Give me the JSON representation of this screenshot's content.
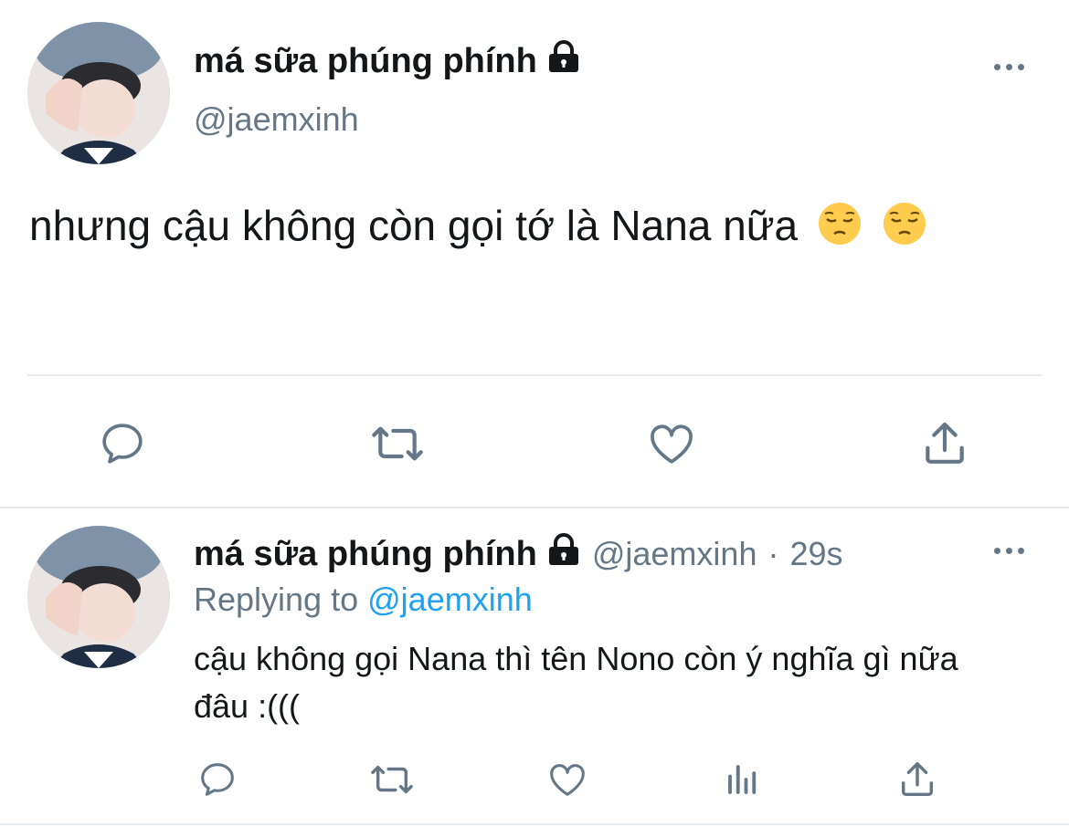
{
  "main_tweet": {
    "display_name": "má sữa phúng phính",
    "handle": "@jaemxinh",
    "text": "nhưng cậu không còn gọi tớ là Nana nữa",
    "emojis": [
      "pensive-face-emoji",
      "pensive-face-emoji"
    ],
    "actions": [
      "reply-icon",
      "retweet-icon",
      "like-icon",
      "share-icon"
    ]
  },
  "reply_tweet": {
    "display_name": "má sữa phúng phính",
    "handle": "@jaemxinh",
    "separator": "·",
    "time": "29s",
    "replying_to_label": "Replying to",
    "replying_to_handle": "@jaemxinh",
    "text": "cậu không gọi Nana thì tên Nono còn ý nghĩa gì nữa đâu :(((",
    "actions": [
      "reply-icon",
      "retweet-icon",
      "like-icon",
      "analytics-icon",
      "share-icon"
    ]
  },
  "colors": {
    "text": "#14171a",
    "secondary": "#657786",
    "link": "#1da1f2",
    "divider": "#e6ecf0",
    "emoji": "#ffcc4d"
  }
}
